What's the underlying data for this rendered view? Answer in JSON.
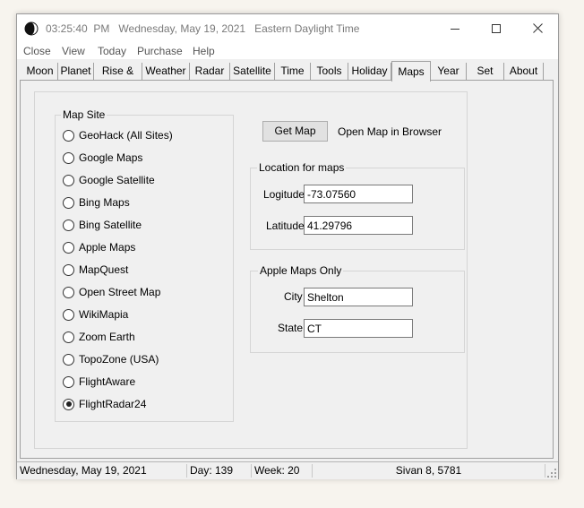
{
  "titlebar": {
    "time": "03:25:40  PM",
    "date": "Wednesday, May 19, 2021",
    "timezone": "Eastern Daylight Time"
  },
  "menu": [
    "Close",
    "View",
    "Today",
    "Purchase",
    "Help"
  ],
  "tabs": [
    "Moon",
    "Planet",
    "Rise & Set",
    "Weather",
    "Radar",
    "Satellite",
    "Time",
    "Tools",
    "Holiday",
    "Maps",
    "Year",
    "Set",
    "About"
  ],
  "active_tab": "Maps",
  "map_site": {
    "title": "Map Site",
    "options": [
      "GeoHack (All Sites)",
      "Google Maps",
      "Google Satellite",
      "Bing Maps",
      "Bing Satellite",
      "Apple Maps",
      "MapQuest",
      "Open Street Map",
      "WikiMapia",
      "Zoom Earth",
      "TopoZone (USA)",
      "FlightAware",
      "FlightRadar24"
    ],
    "selected": "FlightRadar24"
  },
  "actions": {
    "get_map": "Get Map",
    "open_in_browser": "Open Map in Browser"
  },
  "location": {
    "title": "Location for maps",
    "longitude_label": "Logitude",
    "longitude_value": "-73.07560",
    "latitude_label": "Latitude",
    "latitude_value": "41.29796"
  },
  "apple_maps": {
    "title": "Apple Maps Only",
    "city_label": "City",
    "city_value": "Shelton",
    "state_label": "State",
    "state_value": "CT"
  },
  "status": {
    "date": "Wednesday, May 19, 2021",
    "day": "Day: 139",
    "week": "Week: 20",
    "hebrew_date": "Sivan 8, 5781"
  }
}
